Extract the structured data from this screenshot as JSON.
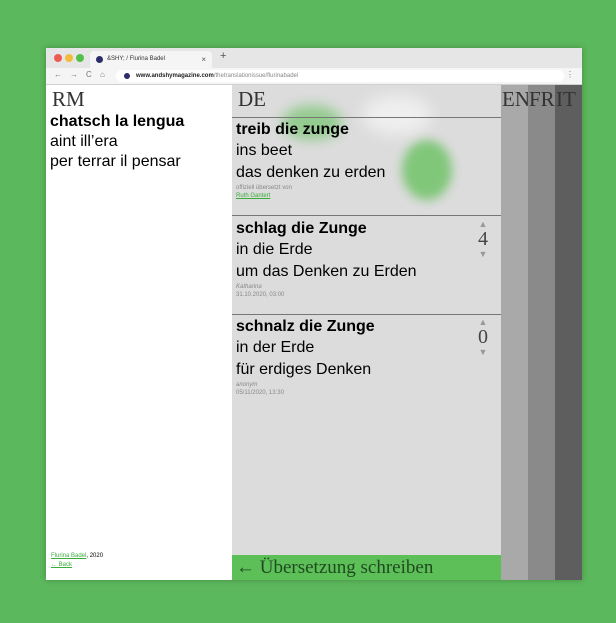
{
  "browser": {
    "tab_title": "&SHY; / Flurina Badel",
    "tab_close": "×",
    "new_tab": "+",
    "url_domain": "www.andshymagazine.com",
    "url_path": "/thetranslationissue/flurinabadel",
    "back": "←",
    "forward": "→",
    "reload": "C",
    "home": "⌂",
    "menu": "⋮"
  },
  "rm": {
    "lang": "RM",
    "title": "chatsch la lengua",
    "lines": [
      "aint ill’era",
      "per terrar il pensar"
    ],
    "author": "Flurina Badel",
    "year": ", 2020",
    "back": "← Back"
  },
  "de": {
    "lang": "DE",
    "translations": [
      {
        "title": "treib die zunge",
        "lines": [
          "ins beet",
          "das denken zu erden"
        ],
        "meta": "offiziell übersetzt von",
        "meta_link": "Ruth Gantert"
      },
      {
        "title": "schlag die Zunge",
        "lines": [
          "in die Erde",
          "um das Denken zu Erden"
        ],
        "author": "Katharina",
        "date": "31.10.2020, 03:00",
        "votes": "4"
      },
      {
        "title": "schnalz die Zunge",
        "lines": [
          "in der Erde",
          "für erdiges Denken"
        ],
        "author": "anonym",
        "date": "05/11/2020, 13:30",
        "votes": "0"
      }
    ],
    "write_arrow": "←",
    "write_label": "Übersetzung schreiben",
    "vote_up": "▲",
    "vote_down": "▼"
  },
  "strips": [
    "EN",
    "FR",
    "IT"
  ],
  "colors": {
    "background": "#5cb85c",
    "accent": "#5dbf58"
  }
}
